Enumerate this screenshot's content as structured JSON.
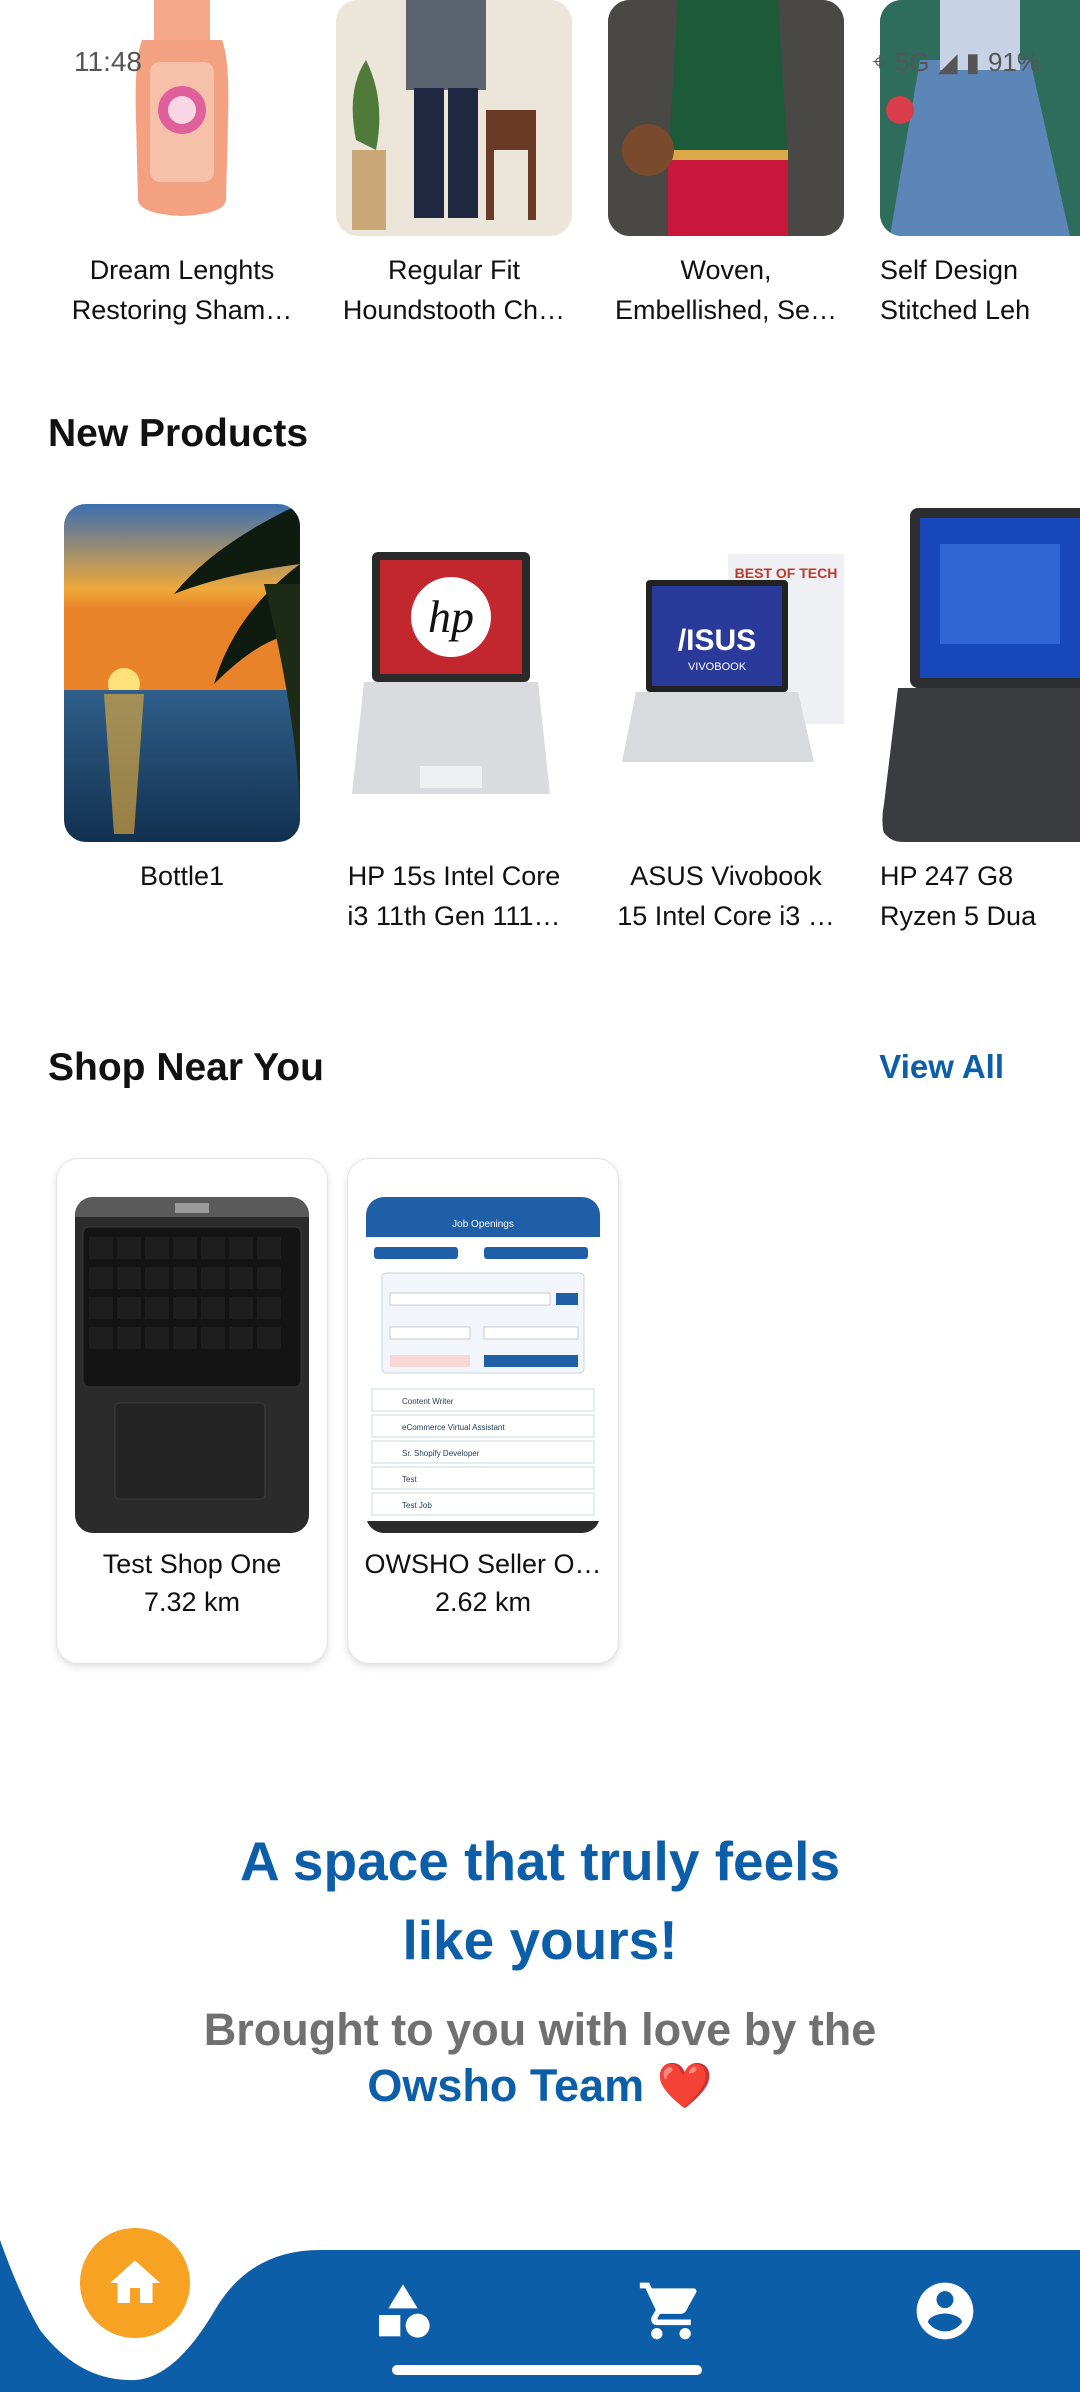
{
  "status_bar": {
    "time": "11:48",
    "network": "5G",
    "battery": "91%"
  },
  "top_products": [
    {
      "title_line1": "Dream Lenghts",
      "title_line2": "Restoring Sham…"
    },
    {
      "title_line1": "Regular Fit",
      "title_line2": "Houndstooth Ch…"
    },
    {
      "title_line1": "Woven,",
      "title_line2": "Embellished, Se…"
    },
    {
      "title_line1": "Self Design",
      "title_line2": "Stitched Leh"
    }
  ],
  "new_products": {
    "title": "New Products",
    "items": [
      {
        "title_line1": "Bottle1",
        "title_line2": ""
      },
      {
        "title_line1": "HP 15s Intel Core",
        "title_line2": "i3 11th Gen 111…",
        "image_text": "hp"
      },
      {
        "title_line1": "ASUS Vivobook",
        "title_line2": "15 Intel Core i3 …",
        "image_text": "/ISUS",
        "image_badge": "BEST OF TECH",
        "image_sub": "VIVOBOOK"
      },
      {
        "title_line1": "HP 247 G8",
        "title_line2": "Ryzen 5 Dua"
      }
    ]
  },
  "shop_near_you": {
    "title": "Shop Near You",
    "view_all": "View All",
    "shops": [
      {
        "name": "Test Shop One",
        "distance": "7.32 km"
      },
      {
        "name": "OWSHO Seller O…",
        "distance": "2.62 km",
        "screenshot_header": "Job Openings",
        "screenshot_rows": [
          "Content Writer",
          "eCommerce Virtual Assistant",
          "Sr. Shopify Developer",
          "Test",
          "Test Job"
        ]
      }
    ]
  },
  "tagline": {
    "line1": "A space that truly feels",
    "line2": "like yours!",
    "line3": "Brought to you with love by the",
    "line4_brand": "Owsho Team",
    "line4_heart": "❤️"
  },
  "bottom_nav": {
    "items": [
      {
        "icon": "home-icon",
        "active": true
      },
      {
        "icon": "categories-icon",
        "active": false
      },
      {
        "icon": "cart-icon",
        "active": false
      },
      {
        "icon": "account-icon",
        "active": false
      }
    ],
    "accent": "#f7a223",
    "bar_color": "#0d5ea8"
  },
  "colors": {
    "brand_blue": "#0d5ea8",
    "muted_gray": "#707070"
  }
}
